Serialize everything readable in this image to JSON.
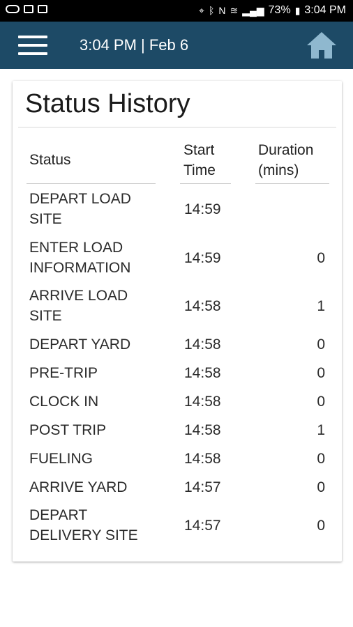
{
  "status_bar": {
    "battery": "73%",
    "time": "3:04 PM"
  },
  "appbar": {
    "title": "3:04 PM | Feb 6",
    "menu_icon": "hamburger-icon",
    "home_icon": "home-icon",
    "color": "#1d4a66"
  },
  "card": {
    "title": "Status History"
  },
  "table": {
    "headers": {
      "status": "Status",
      "start_time": "Start Time",
      "duration": "Duration (mins)"
    },
    "rows": [
      {
        "status": "DEPART LOAD SITE",
        "start": "14:59",
        "duration": ""
      },
      {
        "status": "ENTER LOAD INFORMATION",
        "start": "14:59",
        "duration": "0"
      },
      {
        "status": "ARRIVE LOAD SITE",
        "start": "14:58",
        "duration": "1"
      },
      {
        "status": "DEPART YARD",
        "start": "14:58",
        "duration": "0"
      },
      {
        "status": "PRE-TRIP",
        "start": "14:58",
        "duration": "0"
      },
      {
        "status": "CLOCK IN",
        "start": "14:58",
        "duration": "0"
      },
      {
        "status": "POST TRIP",
        "start": "14:58",
        "duration": "1"
      },
      {
        "status": "FUELING",
        "start": "14:58",
        "duration": "0"
      },
      {
        "status": "ARRIVE YARD",
        "start": "14:57",
        "duration": "0"
      },
      {
        "status": "DEPART DELIVERY SITE",
        "start": "14:57",
        "duration": "0"
      }
    ]
  }
}
